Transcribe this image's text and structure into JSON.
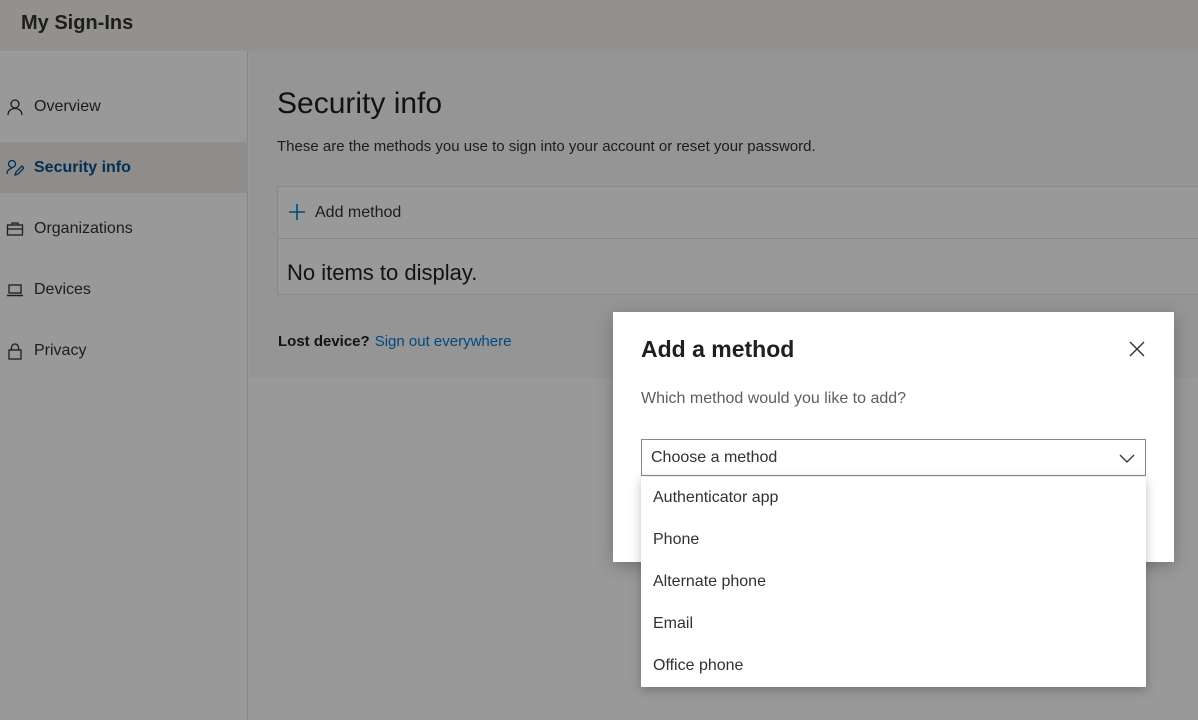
{
  "header": {
    "app_title": "My Sign-Ins"
  },
  "sidebar": {
    "items": [
      {
        "label": "Overview",
        "icon": "person-icon",
        "active": false
      },
      {
        "label": "Security info",
        "icon": "security-info-icon",
        "active": true
      },
      {
        "label": "Organizations",
        "icon": "briefcase-icon",
        "active": false
      },
      {
        "label": "Devices",
        "icon": "laptop-icon",
        "active": false
      },
      {
        "label": "Privacy",
        "icon": "lock-icon",
        "active": false
      }
    ]
  },
  "main": {
    "title": "Security info",
    "subtitle": "These are the methods you use to sign into your account or reset your password.",
    "add_method_label": "Add method",
    "empty_text": "No items to display.",
    "lost_device_label": "Lost device?",
    "sign_out_link": "Sign out everywhere"
  },
  "dialog": {
    "title": "Add a method",
    "question": "Which method would you like to add?",
    "select_value": "Choose a method",
    "options": [
      "Authenticator app",
      "Phone",
      "Alternate phone",
      "Email",
      "Office phone"
    ]
  },
  "colors": {
    "accent": "#0078d4",
    "active_nav_text": "#0a4e8a",
    "overlay": "rgba(0,0,0,0.40)"
  }
}
